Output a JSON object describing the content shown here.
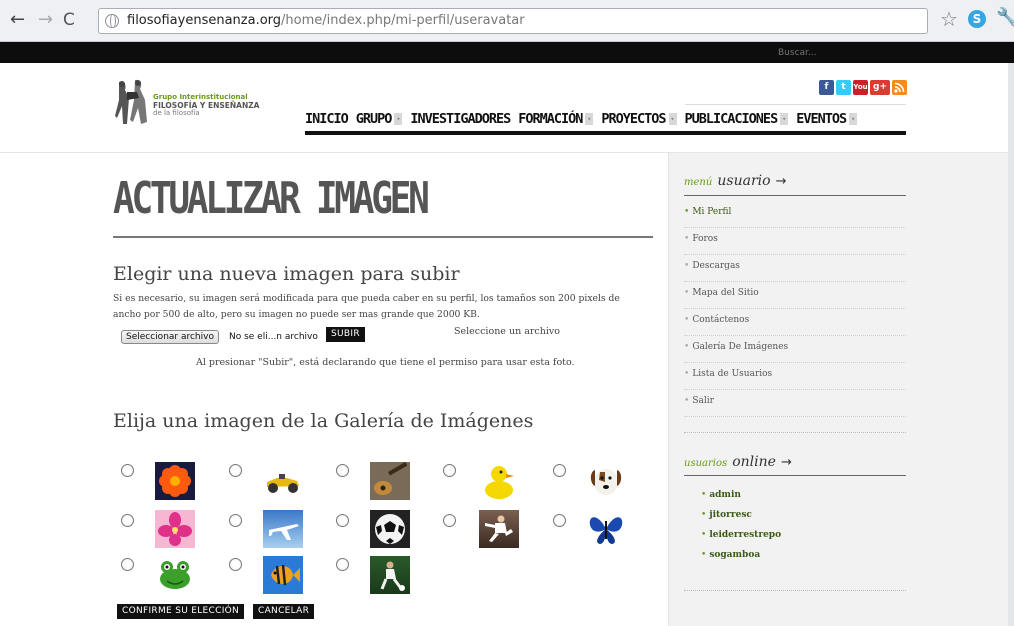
{
  "browser": {
    "url_host": "filosofiayensenanza.org",
    "url_path": "/home/index.php/mi-perfil/useravatar"
  },
  "site": {
    "search_placeholder": "Buscar...",
    "logo": {
      "line1": "Grupo Interinstitucional",
      "line2": "FILOSOFÍA Y ENSEÑANZA",
      "line3": "de la filosofía"
    },
    "social": [
      "f",
      "t",
      "You",
      "g+",
      "rss"
    ],
    "nav": [
      {
        "label": "INICIO",
        "caret": false
      },
      {
        "label": "GRUPO",
        "caret": true
      },
      {
        "label": "INVESTIGADORES",
        "caret": false
      },
      {
        "label": "FORMACIÓN",
        "caret": true
      },
      {
        "label": "PROYECTOS",
        "caret": true
      },
      {
        "label": "PUBLICACIONES",
        "caret": true
      },
      {
        "label": "EVENTOS",
        "caret": true
      }
    ]
  },
  "main": {
    "title": "ACTUALIZAR IMAGEN",
    "upload_heading": "Elegir una nueva imagen para subir",
    "upload_desc": "Si es necesario, su imagen será modificada para que pueda caber en su perfil, los tamaños son 200 pixels de ancho por 500 de alto, pero su imagen no puede ser mas grande que 2000 KB.",
    "file_button": "Seleccionar archivo",
    "file_name": "No se eli...n archivo",
    "upload_button": "SUBIR",
    "select_hint": "Seleccione un archivo",
    "declare": "Al presionar \"Subir\", está declarando que tiene el permiso para usar esta foto.",
    "gallery_heading": "Elija una imagen de la Galería de Imágenes",
    "gallery": [
      "flower",
      "toy-car",
      "guitar",
      "rubber-duck",
      "dog",
      "pink-flower",
      "airplane",
      "soccer-ball",
      "karate",
      "butterfly",
      "frog",
      "fish",
      "soccer-player"
    ],
    "confirm_button": "CONFIRME SU ELECCIÓN",
    "cancel_button": "CANCELAR"
  },
  "sidebar": {
    "menu_small": "menú",
    "menu_big": "usuario",
    "menu_items": [
      {
        "label": "Mi Perfil",
        "active": true
      },
      {
        "label": "Foros",
        "active": false
      },
      {
        "label": "Descargas",
        "active": false
      },
      {
        "label": "Mapa del Sitio",
        "active": false
      },
      {
        "label": "Contáctenos",
        "active": false
      },
      {
        "label": "Galería De Imágenes",
        "active": false
      },
      {
        "label": "Lista de Usuarios",
        "active": false
      },
      {
        "label": "Salir",
        "active": false
      }
    ],
    "online_small": "usuarios",
    "online_big": "online",
    "online_users": [
      "admin",
      "jitorresc",
      "leiderrestrepo",
      "sogamboa"
    ]
  },
  "colors": {
    "accent_green": "#6a9a18",
    "dark": "#111111",
    "sidebar_bg": "#f2f2f2"
  }
}
